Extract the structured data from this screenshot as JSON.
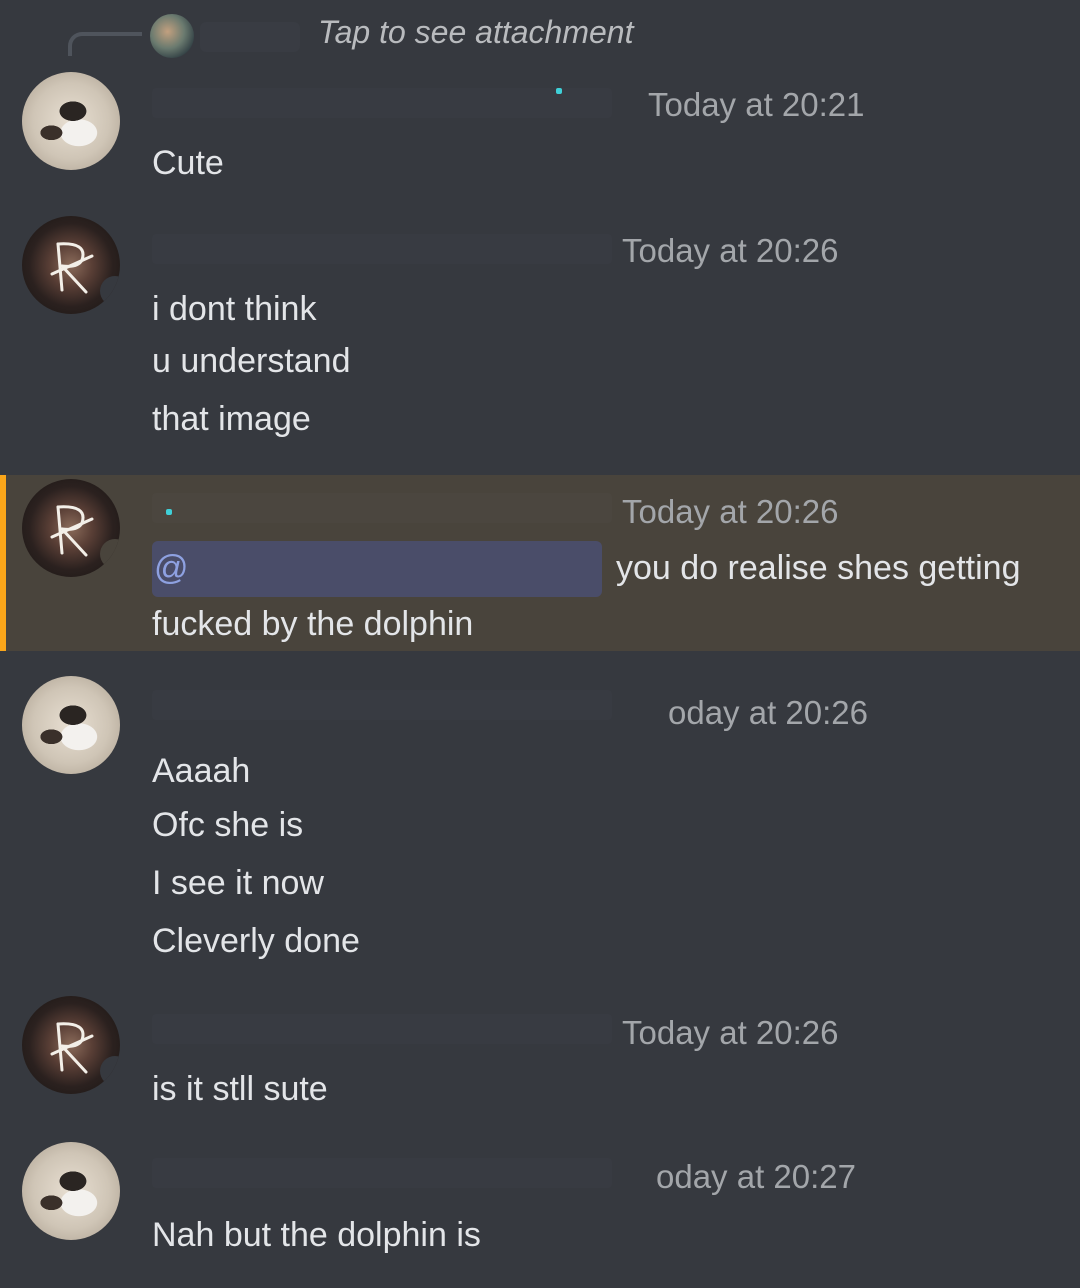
{
  "reply": {
    "text": "Tap to see attachment"
  },
  "messages": [
    {
      "author_avatar": "cat-avatar",
      "time": "Today at 20:21",
      "lines": [
        "Cute"
      ]
    },
    {
      "author_avatar": "r-logo-avatar",
      "time": "Today at 20:26",
      "lines": [
        "i dont think",
        "u understand",
        "that image"
      ]
    },
    {
      "author_avatar": "r-logo-avatar",
      "time": "Today at 20:26",
      "highlighted": true,
      "mention": "@",
      "lines": [
        "you do realise shes getting",
        "fucked by the dolphin"
      ]
    },
    {
      "author_avatar": "cat-avatar",
      "time": "oday at 20:26",
      "lines": [
        "Aaaah",
        "Ofc she is",
        "I see it now",
        "Cleverly done"
      ]
    },
    {
      "author_avatar": "r-logo-avatar",
      "time": "Today at 20:26",
      "lines": [
        "is it stll sute"
      ]
    },
    {
      "author_avatar": "cat-avatar",
      "time": "oday at 20:27",
      "lines": [
        "Nah but the dolphin is"
      ]
    }
  ],
  "colors": {
    "background": "#36393f",
    "highlight_background": "#49443c",
    "highlight_bar": "#faa61a",
    "mention_text": "#8ea1e1",
    "timestamp": "#a3a6aa"
  }
}
